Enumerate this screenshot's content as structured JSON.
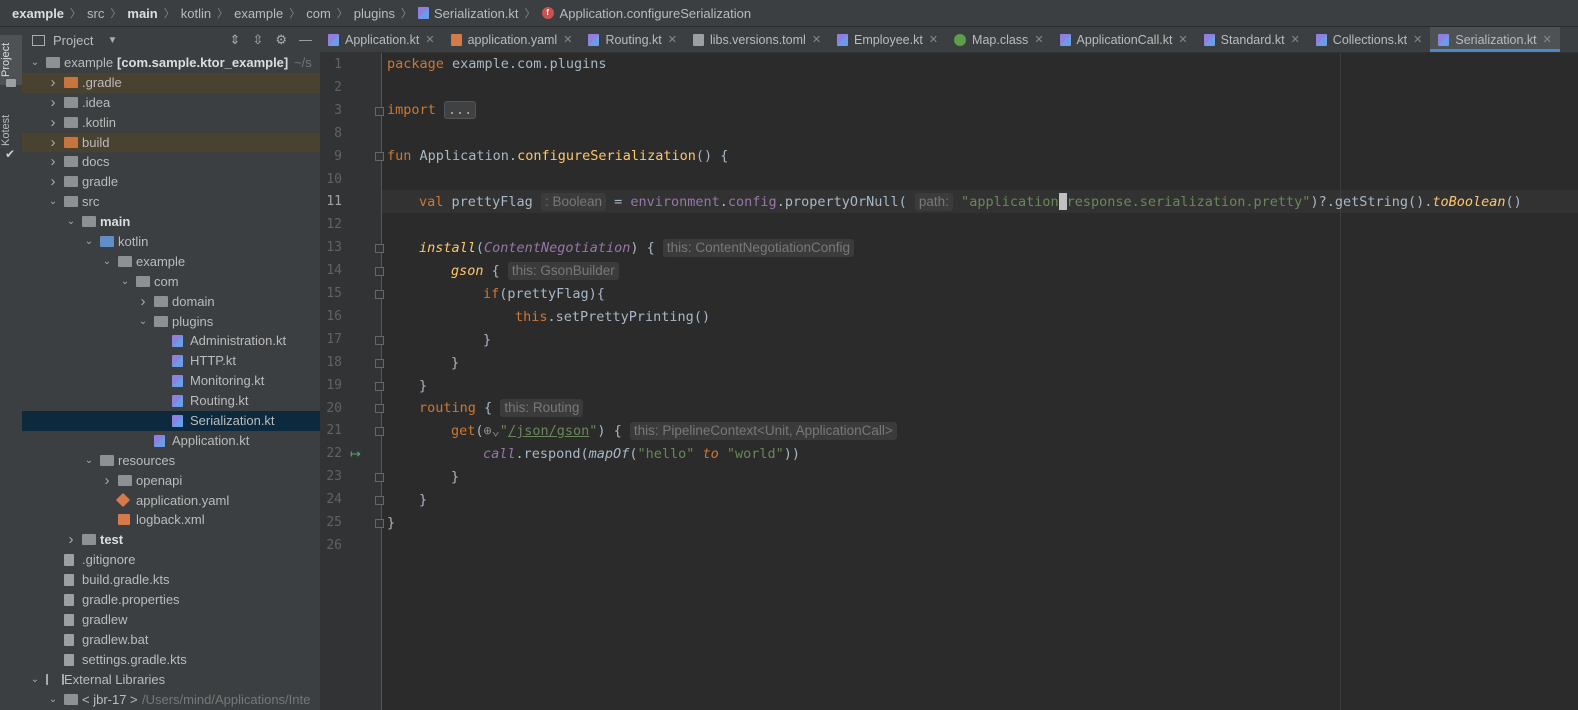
{
  "breadcrumb": {
    "items": [
      "example",
      "src",
      "main",
      "kotlin",
      "example",
      "com",
      "plugins",
      "Serialization.kt",
      "Application.configureSerialization"
    ]
  },
  "toolstrip": {
    "project_label": "Project",
    "kotest_label": "Kotest"
  },
  "project_panel": {
    "title": "Project",
    "tree": [
      {
        "label": "example",
        "suffix": "[com.sample.ktor_example]",
        "path": "~/s",
        "depth": 0,
        "expanded": true,
        "icon": "module-folder-icon"
      },
      {
        "label": ".gradle",
        "depth": 1,
        "expanded": false,
        "icon": "folder-orange-icon",
        "highlight": "orange"
      },
      {
        "label": ".idea",
        "depth": 1,
        "expanded": false,
        "icon": "folder-icon"
      },
      {
        "label": ".kotlin",
        "depth": 1,
        "expanded": false,
        "icon": "folder-icon"
      },
      {
        "label": "build",
        "depth": 1,
        "expanded": false,
        "icon": "folder-orange-icon",
        "highlight": "orange"
      },
      {
        "label": "docs",
        "depth": 1,
        "expanded": false,
        "icon": "folder-icon"
      },
      {
        "label": "gradle",
        "depth": 1,
        "expanded": false,
        "icon": "folder-icon"
      },
      {
        "label": "src",
        "depth": 1,
        "expanded": true,
        "icon": "folder-icon"
      },
      {
        "label": "main",
        "depth": 2,
        "expanded": true,
        "icon": "folder-icon",
        "bold": true
      },
      {
        "label": "kotlin",
        "depth": 3,
        "expanded": true,
        "icon": "source-folder-icon"
      },
      {
        "label": "example",
        "depth": 4,
        "expanded": true,
        "icon": "package-icon"
      },
      {
        "label": "com",
        "depth": 5,
        "expanded": true,
        "icon": "package-icon"
      },
      {
        "label": "domain",
        "depth": 6,
        "expanded": false,
        "icon": "package-icon"
      },
      {
        "label": "plugins",
        "depth": 6,
        "expanded": true,
        "icon": "package-icon"
      },
      {
        "label": "Administration.kt",
        "depth": 7,
        "icon": "kotlin-file-icon"
      },
      {
        "label": "HTTP.kt",
        "depth": 7,
        "icon": "kotlin-file-icon"
      },
      {
        "label": "Monitoring.kt",
        "depth": 7,
        "icon": "kotlin-file-icon"
      },
      {
        "label": "Routing.kt",
        "depth": 7,
        "icon": "kotlin-file-icon"
      },
      {
        "label": "Serialization.kt",
        "depth": 7,
        "icon": "kotlin-file-icon",
        "selected": true
      },
      {
        "label": "Application.kt",
        "depth": 6,
        "icon": "kotlin-file-icon"
      },
      {
        "label": "resources",
        "depth": 3,
        "expanded": true,
        "icon": "resources-folder-icon"
      },
      {
        "label": "openapi",
        "depth": 4,
        "expanded": false,
        "icon": "folder-icon"
      },
      {
        "label": "application.yaml",
        "depth": 4,
        "icon": "yaml-file-icon"
      },
      {
        "label": "logback.xml",
        "depth": 4,
        "icon": "xml-file-icon"
      },
      {
        "label": "test",
        "depth": 2,
        "expanded": false,
        "icon": "folder-icon",
        "bold": true
      },
      {
        "label": ".gitignore",
        "depth": 1,
        "icon": "file-icon"
      },
      {
        "label": "build.gradle.kts",
        "depth": 1,
        "icon": "gradle-file-icon"
      },
      {
        "label": "gradle.properties",
        "depth": 1,
        "icon": "properties-file-icon"
      },
      {
        "label": "gradlew",
        "depth": 1,
        "icon": "script-file-icon"
      },
      {
        "label": "gradlew.bat",
        "depth": 1,
        "icon": "file-icon"
      },
      {
        "label": "settings.gradle.kts",
        "depth": 1,
        "icon": "gradle-file-icon"
      },
      {
        "label": "External Libraries",
        "depth": 0,
        "expanded": true,
        "icon": "libraries-icon"
      },
      {
        "label": "< jbr-17 >",
        "path": "/Users/mind/Applications/Inte",
        "depth": 1,
        "expanded": true,
        "icon": "folder-icon"
      }
    ]
  },
  "tabs": [
    {
      "label": "Application.kt",
      "icon": "kotlin-file-icon"
    },
    {
      "label": "application.yaml",
      "icon": "yaml-file-icon"
    },
    {
      "label": "Routing.kt",
      "icon": "kotlin-file-icon"
    },
    {
      "label": "libs.versions.toml",
      "icon": "file-icon"
    },
    {
      "label": "Employee.kt",
      "icon": "kotlin-file-icon"
    },
    {
      "label": "Map.class",
      "icon": "interface-icon"
    },
    {
      "label": "ApplicationCall.kt",
      "icon": "kotlin-file-icon"
    },
    {
      "label": "Standard.kt",
      "icon": "kotlin-file-icon"
    },
    {
      "label": "Collections.kt",
      "icon": "kotlin-file-icon"
    },
    {
      "label": "Serialization.kt",
      "icon": "kotlin-file-icon",
      "active": true
    }
  ],
  "editor": {
    "current_line": 11,
    "line_numbers": [
      "1",
      "2",
      "3",
      "8",
      "9",
      "10",
      "11",
      "12",
      "13",
      "14",
      "15",
      "16",
      "17",
      "18",
      "19",
      "20",
      "21",
      "22",
      "23",
      "24",
      "25",
      "26"
    ],
    "code": {
      "package_kw": "package",
      "package_name": " example.com.plugins",
      "import_kw": "import",
      "import_fold": "...",
      "fun_kw": "fun",
      "fun_receiver": " Application.",
      "fun_name": "configureSerialization",
      "fun_tail": "() {",
      "val_kw": "val",
      "val_name": " prettyFlag",
      "val_hint": ": Boolean",
      "val_eq": " = ",
      "env": "environment",
      "dot1": ".",
      "config": "config",
      "call1": ".propertyOrNull(",
      "path_hint": "path:",
      "str_a": "\"application",
      "str_b": "response.serialization.pretty\"",
      "tail11a": ")?.getString().",
      "to_bool": "toBoolean",
      "tail11b": "()",
      "install": "install",
      "cn_open": "(",
      "cn": "ContentNegotiation",
      "cn_close": ") {",
      "cn_hint": "this: ContentNegotiationConfig",
      "gson": "gson",
      "gson_brace": " {",
      "gson_hint": "this: GsonBuilder",
      "if_kw": "if",
      "if_cond": "(prettyFlag){",
      "this_kw": "this",
      "pretty_call": ".setPrettyPrinting()",
      "close1": "}",
      "close2": "}",
      "close3": "}",
      "routing": "routing",
      "routing_brace": " {",
      "routing_hint": "this: Routing",
      "get": "get",
      "get_open": "(",
      "url_q1": "\"",
      "url": "/json/gson",
      "url_q2": "\"",
      "get_close": ") {",
      "get_hint": "this: PipelineContext<Unit, ApplicationCall>",
      "call": "call",
      "respond": ".respond(",
      "mapof": "mapOf",
      "paren_open": "(",
      "hello": "\"hello\"",
      "to_kw": " to ",
      "world": "\"world\"",
      "paren_close": "))",
      "close4": "}",
      "close5": "}",
      "close6": "}"
    }
  }
}
